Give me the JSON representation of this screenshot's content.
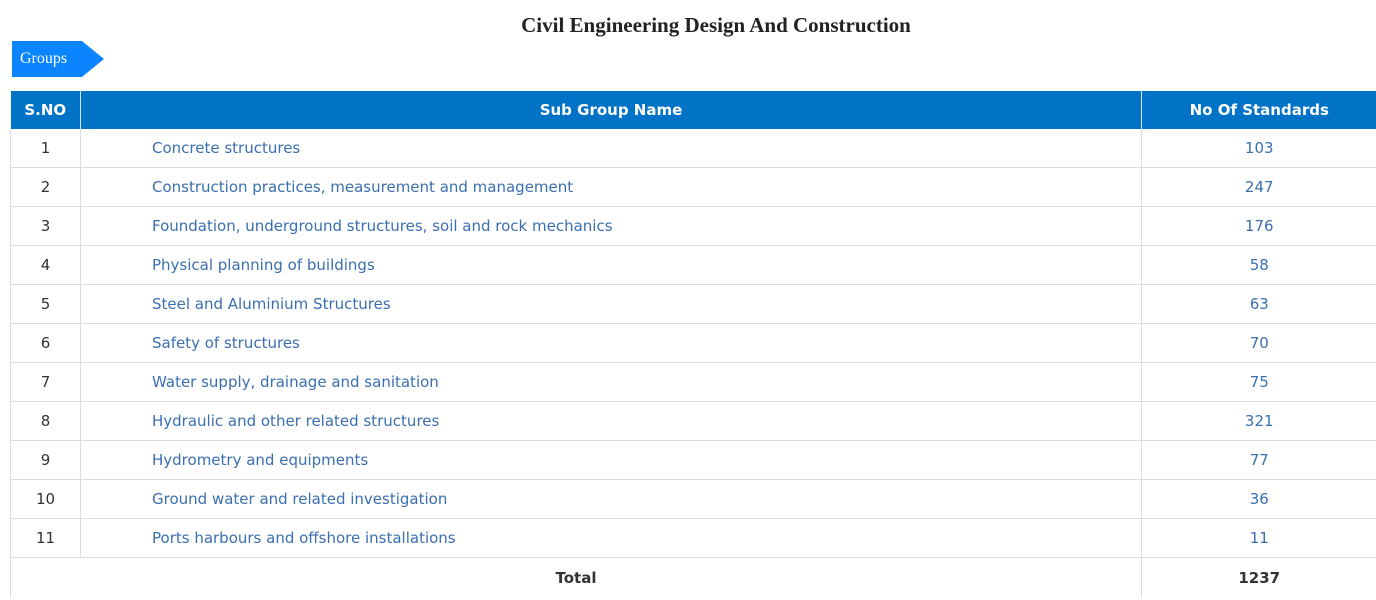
{
  "page": {
    "title": "Civil Engineering Design And Construction",
    "groups_label": "Groups"
  },
  "table": {
    "headers": {
      "sno": "S.NO",
      "name": "Sub Group Name",
      "count": "No Of Standards"
    },
    "rows": [
      {
        "sno": "1",
        "name": "Concrete structures",
        "count": "103"
      },
      {
        "sno": "2",
        "name": "Construction practices, measurement and management",
        "count": "247"
      },
      {
        "sno": "3",
        "name": "Foundation, underground structures, soil and rock mechanics",
        "count": "176"
      },
      {
        "sno": "4",
        "name": "Physical planning of buildings",
        "count": "58"
      },
      {
        "sno": "5",
        "name": "Steel and Aluminium Structures",
        "count": "63"
      },
      {
        "sno": "6",
        "name": "Safety of structures",
        "count": "70"
      },
      {
        "sno": "7",
        "name": "Water supply, drainage and sanitation",
        "count": "75"
      },
      {
        "sno": "8",
        "name": "Hydraulic and other related structures",
        "count": "321"
      },
      {
        "sno": "9",
        "name": "Hydrometry and equipments",
        "count": "77"
      },
      {
        "sno": "10",
        "name": "Ground water and related investigation",
        "count": "36"
      },
      {
        "sno": "11",
        "name": "Ports harbours and offshore installations",
        "count": "11"
      }
    ],
    "total": {
      "label": "Total",
      "value": "1237"
    }
  },
  "colors": {
    "header_bg": "#0073c6",
    "groups_tag_bg": "#0a84ff",
    "link_text": "#3a6fb0"
  }
}
